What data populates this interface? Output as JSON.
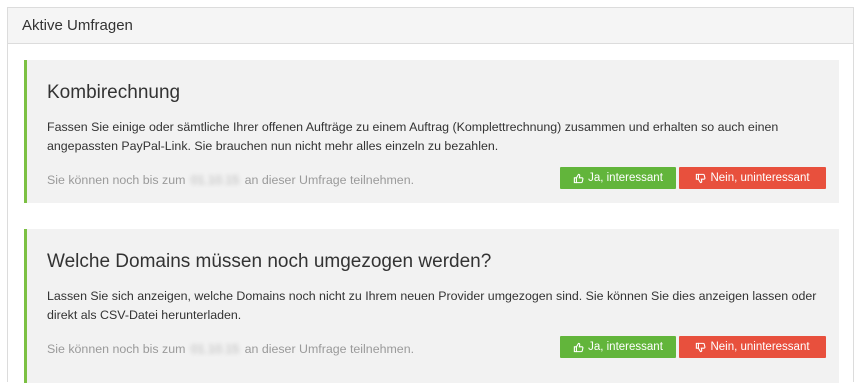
{
  "panel": {
    "title": "Aktive Umfragen"
  },
  "surveys": [
    {
      "title": "Kombirechnung",
      "description": "Fassen Sie einige oder sämtliche Ihrer offenen Aufträge zu einem Auftrag (Komplettrechnung) zusammen und erhalten so auch einen angepassten PayPal-Link. Sie brauchen nun nicht mehr alles einzeln zu bezahlen.",
      "note_before": "Sie können noch bis zum",
      "date_redacted": "01.10.15",
      "note_after": "an dieser Umfrage teilnehmen.",
      "yes_label": "Ja, interessant",
      "no_label": "Nein, uninteressant"
    },
    {
      "title": "Welche Domains müssen noch umgezogen werden?",
      "description": "Lassen Sie sich anzeigen, welche Domains noch nicht zu Ihrem neuen Provider umgezogen sind. Sie können Sie dies anzeigen lassen oder direkt als CSV-Datei herunterladen.",
      "note_before": "Sie können noch bis zum",
      "date_redacted": "01.10.15",
      "note_after": "an dieser Umfrage teilnehmen.",
      "yes_label": "Ja, interessant",
      "no_label": "Nein, uninteressant"
    }
  ],
  "icons": {
    "yes": "thumbs-up-icon",
    "no": "thumbs-down-icon"
  },
  "colors": {
    "accent": "#7cc043",
    "yes_button": "#62b53b",
    "no_button": "#e8503d"
  }
}
